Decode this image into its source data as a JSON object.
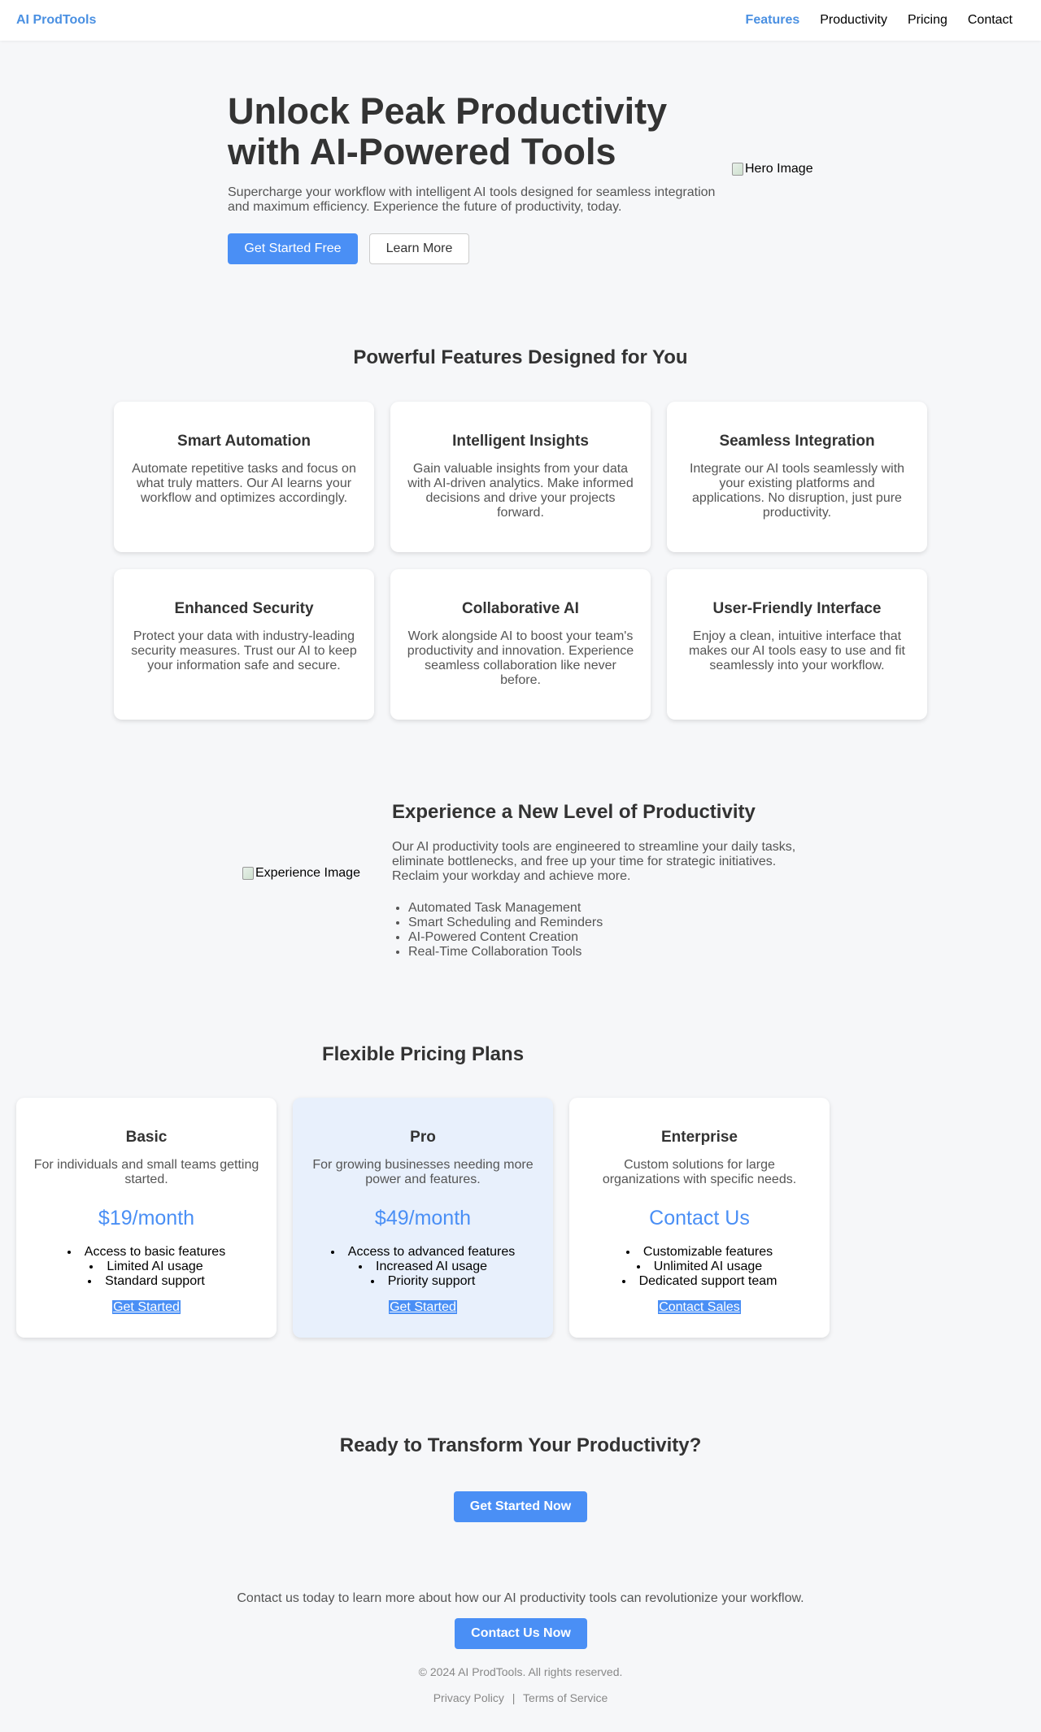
{
  "nav": {
    "brand": "AI ProdTools",
    "links": [
      "Features",
      "Productivity",
      "Pricing",
      "Contact"
    ]
  },
  "hero": {
    "title": "Unlock Peak Productivity with AI-Powered Tools",
    "subtitle": "Supercharge your workflow with intelligent AI tools designed for seamless integration and maximum efficiency. Experience the future of productivity, today.",
    "primary_button": "Get Started Free",
    "secondary_button": "Learn More",
    "image_alt": "Hero Image"
  },
  "features": {
    "title": "Powerful Features Designed for You",
    "items": [
      {
        "title": "Smart Automation",
        "text": "Automate repetitive tasks and focus on what truly matters. Our AI learns your workflow and optimizes accordingly."
      },
      {
        "title": "Intelligent Insights",
        "text": "Gain valuable insights from your data with AI-driven analytics. Make informed decisions and drive your projects forward."
      },
      {
        "title": "Seamless Integration",
        "text": "Integrate our AI tools seamlessly with your existing platforms and applications. No disruption, just pure productivity."
      },
      {
        "title": "Enhanced Security",
        "text": "Protect your data with industry-leading security measures. Trust our AI to keep your information safe and secure."
      },
      {
        "title": "Collaborative AI",
        "text": "Work alongside AI to boost your team's productivity and innovation. Experience seamless collaboration like never before."
      },
      {
        "title": "User-Friendly Interface",
        "text": "Enjoy a clean, intuitive interface that makes our AI tools easy to use and fit seamlessly into your workflow."
      }
    ]
  },
  "experience": {
    "image_alt": "Experience Image",
    "title": "Experience a New Level of Productivity",
    "text": "Our AI productivity tools are engineered to streamline your daily tasks, eliminate bottlenecks, and free up your time for strategic initiatives. Reclaim your workday and achieve more.",
    "list": [
      "Automated Task Management",
      "Smart Scheduling and Reminders",
      "AI-Powered Content Creation",
      "Real-Time Collaboration Tools"
    ]
  },
  "pricing": {
    "title": "Flexible Pricing Plans",
    "plans": [
      {
        "name": "Basic",
        "desc": "For individuals and small teams getting started.",
        "price": "$19/month",
        "features": [
          "Access to basic features",
          "Limited AI usage",
          "Standard support"
        ],
        "cta": "Get Started"
      },
      {
        "name": "Pro",
        "desc": "For growing businesses needing more power and features.",
        "price": "$49/month",
        "features": [
          "Access to advanced features",
          "Increased AI usage",
          "Priority support"
        ],
        "cta": "Get Started"
      },
      {
        "name": "Enterprise",
        "desc": "Custom solutions for large organizations with specific needs.",
        "price": "Contact Us",
        "features": [
          "Customizable features",
          "Unlimited AI usage",
          "Dedicated support team"
        ],
        "cta": "Contact Sales"
      }
    ]
  },
  "cta": {
    "title": "Ready to Transform Your Productivity?",
    "button": "Get Started Now"
  },
  "footer": {
    "text": "Contact us today to learn more about how our AI productivity tools can revolutionize your workflow.",
    "button": "Contact Us Now",
    "copyright": "© 2024 AI ProdTools. All rights reserved.",
    "privacy": "Privacy Policy",
    "separator": "|",
    "terms": "Terms of Service"
  },
  "colors": {
    "accent": "#4a8ff5",
    "background": "#f6f7f9",
    "pro_card": "#e8f0fc"
  }
}
